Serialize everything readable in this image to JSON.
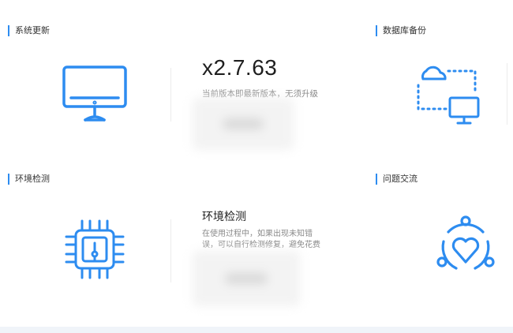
{
  "sections": {
    "system_update": {
      "title": "系统更新",
      "icon": "monitor-icon"
    },
    "db_backup": {
      "title": "数据库备份",
      "icon": "cloud-sync-icon"
    },
    "env_check": {
      "title": "环境检测",
      "icon": "chip-icon"
    },
    "qa": {
      "title": "问题交流",
      "icon": "heart-share-icon"
    }
  },
  "update": {
    "version": "x2.7.63",
    "status": "当前版本即最新版本，无须升级"
  },
  "env": {
    "heading": "环境检测",
    "desc_line1": "在使用过程中，如果出现未知错",
    "desc_line2": "误，可以自行检测修复，避免花费"
  },
  "colors": {
    "accent": "#2d8cf0",
    "text": "#333333",
    "muted": "#8a8a8a"
  }
}
